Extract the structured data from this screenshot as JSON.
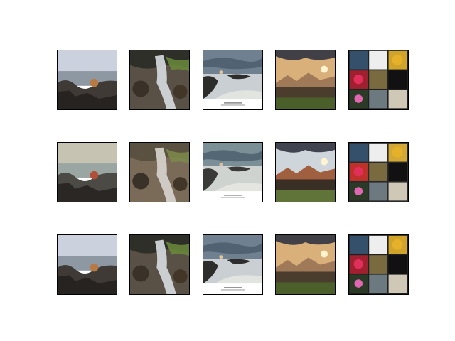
{
  "figure": {
    "rows": [
      {
        "row_index": 0,
        "items": [
          {
            "scene": "rocky-coast",
            "palette": {
              "sky": "#cbd2dd",
              "water": "#8d98a3",
              "rock": "#3f3a36",
              "accent": "#b87a45"
            }
          },
          {
            "scene": "waterfall",
            "palette": {
              "sky": "#2f2f2a",
              "water": "#d7dde0",
              "rock": "#5a5146",
              "accent": "#6a8a3a"
            }
          },
          {
            "scene": "coast-with-caption",
            "palette": {
              "sky": "#6f8090",
              "water": "#c9cfd3",
              "rock": "#2d2d2b",
              "accent": "#e0c39a"
            },
            "caption_lines": [
              "",
              ""
            ]
          },
          {
            "scene": "mountain-sunset",
            "palette": {
              "sky": "#d9b07a",
              "water": "#a07a58",
              "rock": "#4a3d2d",
              "accent": "#4b5f2a"
            }
          },
          {
            "scene": "collage",
            "palette": {
              "sky": "#202020",
              "water": "#d0a32a",
              "rock": "#a02030",
              "accent": "#6b7f3a"
            }
          }
        ]
      },
      {
        "row_index": 1,
        "items": [
          {
            "scene": "rocky-coast",
            "palette": {
              "sky": "#c7c3b3",
              "water": "#9aa6a2",
              "rock": "#4b4a45",
              "accent": "#b0503a"
            }
          },
          {
            "scene": "waterfall",
            "palette": {
              "sky": "#5b5140",
              "water": "#d8d6cf",
              "rock": "#7a6b59",
              "accent": "#7c8a4a"
            }
          },
          {
            "scene": "coast-with-caption",
            "palette": {
              "sky": "#7b8f96",
              "water": "#cfd3cf",
              "rock": "#3a3b38",
              "accent": "#d7bda0"
            },
            "caption_lines": [
              "",
              ""
            ]
          },
          {
            "scene": "mountain-sunset",
            "palette": {
              "sky": "#cfd6db",
              "water": "#a06040",
              "rock": "#3a2f24",
              "accent": "#607338"
            }
          },
          {
            "scene": "collage",
            "palette": {
              "sky": "#2a2a2a",
              "water": "#d4a835",
              "rock": "#c0302a",
              "accent": "#6e8840"
            }
          }
        ]
      },
      {
        "row_index": 2,
        "items": [
          {
            "scene": "rocky-coast",
            "palette": {
              "sky": "#cbd2dd",
              "water": "#8d98a3",
              "rock": "#3f3a36",
              "accent": "#b87a45"
            }
          },
          {
            "scene": "waterfall",
            "palette": {
              "sky": "#2f2f2a",
              "water": "#d7dde0",
              "rock": "#5a5146",
              "accent": "#6a8a3a"
            }
          },
          {
            "scene": "coast-with-caption",
            "palette": {
              "sky": "#6f8090",
              "water": "#c9cfd3",
              "rock": "#2d2d2b",
              "accent": "#e0c39a"
            },
            "caption_lines": [
              "",
              ""
            ]
          },
          {
            "scene": "mountain-sunset",
            "palette": {
              "sky": "#d9b07a",
              "water": "#a07a58",
              "rock": "#4a3d2d",
              "accent": "#4b5f2a"
            }
          },
          {
            "scene": "collage",
            "palette": {
              "sky": "#202020",
              "water": "#d0a32a",
              "rock": "#a02030",
              "accent": "#6b7f3a"
            }
          }
        ]
      }
    ]
  }
}
